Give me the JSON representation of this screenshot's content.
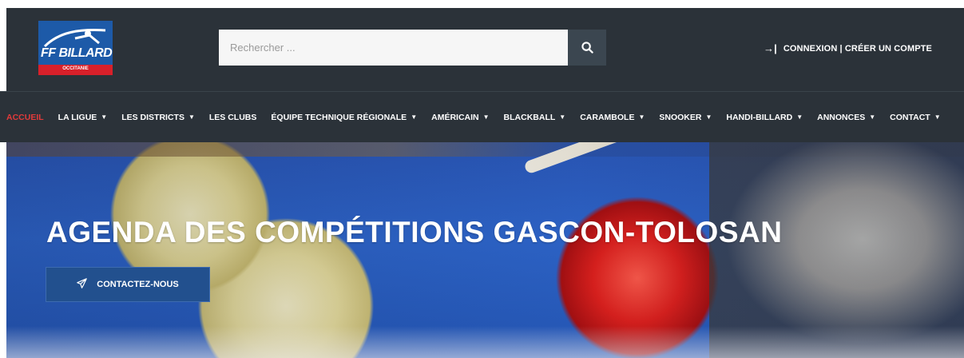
{
  "logo": {
    "text": "FF BILLARD",
    "subtitle": "OCCITANIE",
    "colors": {
      "blue": "#1d5aa8",
      "red": "#d8202a"
    }
  },
  "search": {
    "placeholder": "Rechercher ...",
    "value": "",
    "button_icon": "search-icon"
  },
  "account": {
    "icon": "login-arrow-icon",
    "label": "CONNEXION | CRÉER UN COMPTE"
  },
  "nav": {
    "items": [
      {
        "label": "ACCUEIL",
        "dropdown": false,
        "active": true
      },
      {
        "label": "LA LIGUE",
        "dropdown": true
      },
      {
        "label": "LES DISTRICTS",
        "dropdown": true
      },
      {
        "label": "LES CLUBS",
        "dropdown": false
      },
      {
        "label": "ÉQUIPE TECHNIQUE RÉGIONALE",
        "dropdown": true
      },
      {
        "label": "AMÉRICAIN",
        "dropdown": true
      },
      {
        "label": "BLACKBALL",
        "dropdown": true
      },
      {
        "label": "CARAMBOLE",
        "dropdown": true
      },
      {
        "label": "SNOOKER",
        "dropdown": true
      },
      {
        "label": "HANDI-BILLARD",
        "dropdown": true
      },
      {
        "label": "ANNONCES",
        "dropdown": true
      },
      {
        "label": "CONTACT",
        "dropdown": true
      }
    ],
    "active_color": "#e23a3a"
  },
  "hero": {
    "title": "AGENDA DES COMPÉTITIONS GASCON-TOLOSAN",
    "cta_label": "CONTACTEZ-NOUS",
    "cta_icon": "paper-plane-icon"
  },
  "colors": {
    "header_bg": "#2b3239",
    "cta_bg": "#22508e"
  }
}
